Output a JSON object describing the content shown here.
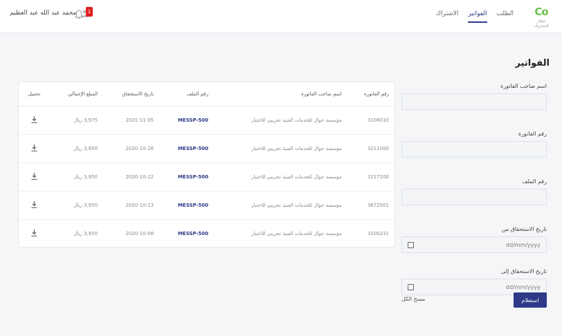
{
  "brand": {
    "mark_a": "C",
    "mark_b": "o",
    "sub": "شعار المصرف"
  },
  "nav": [
    {
      "label": "الطلب",
      "active": false
    },
    {
      "label": "الفواتير",
      "active": true
    },
    {
      "label": "الاشتراك",
      "active": false
    }
  ],
  "user": {
    "name": "محمد عبد الله عبد العظيم",
    "notifications": "1"
  },
  "page_title": "الفواتير",
  "filters": {
    "customer_name_label": "اسم صاحب الفاتورة",
    "invoice_number_label": "رقم الفاتورة",
    "file_number_label": "رقم الملف",
    "due_from_label": "تاريخ الاستحقاق من",
    "due_from_placeholder": "dd/mm/yyyy",
    "due_to_label": "تاريخ الاستحقاق إلى",
    "due_to_placeholder": "dd/mm/yyyy",
    "search_label": "استعلام",
    "clear_label": "مسح الكل"
  },
  "table": {
    "headers": [
      "رقم الفاتورة",
      "اسم صاحب الفاتورة",
      "رقم الملف",
      "تاريخ الاستحقاق",
      "المبلغ الإجمالي",
      "تحميل"
    ],
    "rows": [
      [
        "3108010",
        "مؤسسة جوال للخدمات الفنية تجريبي للاختبار",
        "MESSP-500",
        "2021-11-05",
        "3,975 ريال",
        ""
      ],
      [
        "3211000",
        "مؤسسة جوال للخدمات الفنية تجريبي للاختبار",
        "MESSP-500",
        "2020-10-26",
        "3,950 ريال",
        ""
      ],
      [
        "3117200",
        "مؤسسة جوال للخدمات الفنية تجريبي للاختبار",
        "MESSP-500",
        "2020-10-22",
        "3,950 ريال",
        ""
      ],
      [
        "3872001",
        "مؤسسة جوال للخدمات الفنية تجريبي للاختبار",
        "MESSP-500",
        "2020-10-13",
        "3,950 ريال",
        ""
      ],
      [
        "3100231",
        "مؤسسة جوال للخدمات الفنية تجريبي للاختبار",
        "MESSP-500",
        "2020-10-08",
        "3,950 ريال",
        ""
      ]
    ]
  }
}
